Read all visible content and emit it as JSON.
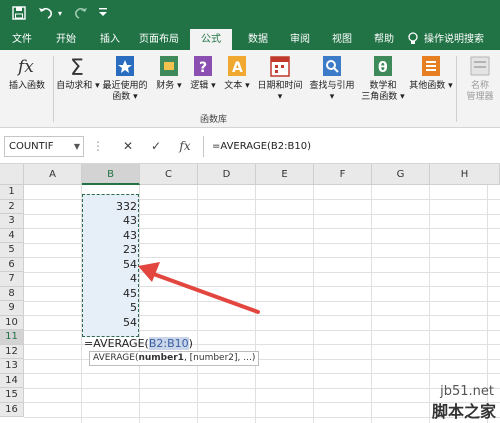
{
  "quick_access": {
    "save_icon": "save-icon",
    "undo_icon": "undo-icon",
    "redo_icon": "redo-icon",
    "more_icon": "customize-icon"
  },
  "tabs": [
    "文件",
    "开始",
    "插入",
    "页面布局",
    "公式",
    "数据",
    "审阅",
    "视图",
    "帮助"
  ],
  "tell_me": "操作说明搜索",
  "ribbon": {
    "insert_function": "插入函数",
    "autosum": "自动求和",
    "recent_line1": "最近使用的",
    "recent_line2": "函数",
    "financial": "财务",
    "logical": "逻辑",
    "text": "文本",
    "datetime": "日期和时间",
    "lookup": "查找与引用",
    "math_line1": "数学和",
    "math_line2": "三角函数",
    "more": "其他函数",
    "name_mgr_line1": "名称",
    "name_mgr_line2": "管理器",
    "group_label": "函数库"
  },
  "formula_bar": {
    "name_box": "COUNTIF",
    "cancel": "✕",
    "enter": "✓",
    "fx": "fx",
    "formula": "=AVERAGE(B2:B10)"
  },
  "columns": [
    "A",
    "B",
    "C",
    "D",
    "E",
    "F",
    "G",
    "H"
  ],
  "rows": [
    "1",
    "2",
    "3",
    "4",
    "5",
    "6",
    "7",
    "8",
    "9",
    "10",
    "11",
    "12",
    "13",
    "14",
    "15",
    "16"
  ],
  "cells": [
    "332",
    "43",
    "43",
    "23",
    "54",
    "4",
    "45",
    "5",
    "54"
  ],
  "entry": {
    "prefix": "=AVERAGE(",
    "ref": "B2:B10",
    "suffix": ")"
  },
  "tooltip": {
    "fn": "AVERAGE(",
    "arg1": "number1",
    "rest": ", [number2], ...)"
  },
  "watermark": {
    "url": "jb51.net",
    "name": "脚本之家"
  }
}
